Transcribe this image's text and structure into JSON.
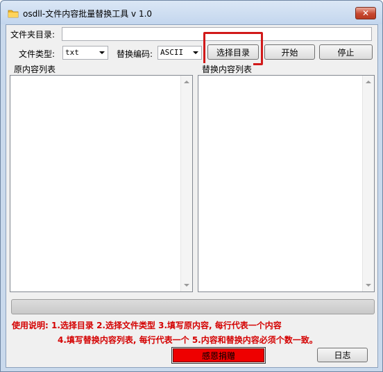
{
  "window": {
    "title": "osdll-文件内容批量替换工具 v 1.0",
    "close_glyph": "✕"
  },
  "folder": {
    "label": "文件夹目录:",
    "value": ""
  },
  "file_type": {
    "label": "文件类型:",
    "selected": "txt"
  },
  "encoding": {
    "label": "替换编码:",
    "selected": "ASCII"
  },
  "buttons": {
    "select_dir": "选择目录",
    "start": "开始",
    "stop": "停止",
    "donate": "感恩捐赠",
    "log": "日志"
  },
  "lists": {
    "original_label": "原内容列表",
    "replace_label": "替换内容列表"
  },
  "progress": {
    "value": 0
  },
  "instructions": {
    "line1": "使用说明: 1.选择目录   2.选择文件类型   3.填写原内容, 每行代表一个内容",
    "line2": "4.填写替换内容列表, 每行代表一个   5.内容和替换内容必须个数一致。"
  },
  "colors": {
    "highlight_box": "#d11a1a",
    "instruction_text": "#d40000",
    "donate_button": "#ee0000"
  }
}
